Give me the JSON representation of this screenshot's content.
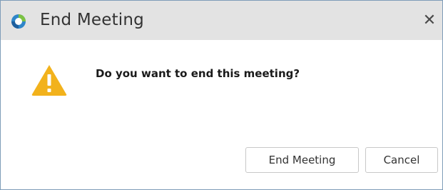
{
  "window": {
    "title": "End Meeting",
    "app_icon": "app-logo-icon",
    "close_icon": "close-icon",
    "close_glyph": "✕"
  },
  "dialog": {
    "icon": "warning-icon",
    "message": "Do you want to end this meeting?",
    "buttons": {
      "end_meeting": "End Meeting",
      "cancel": "Cancel"
    }
  },
  "colors": {
    "titlebar": "#e3e3e3",
    "warning": "#f2b21c",
    "border": "#7f9db9"
  }
}
